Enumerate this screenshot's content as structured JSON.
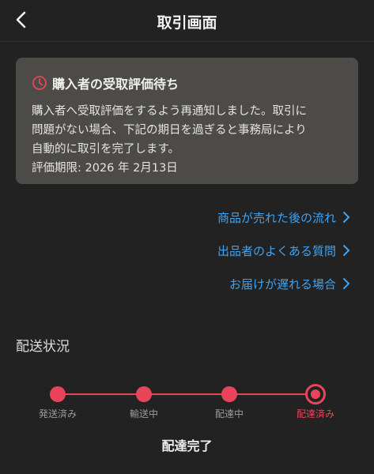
{
  "header": {
    "title": "取引画面",
    "back_icon": "chevron-left-icon"
  },
  "notice": {
    "icon": "clock-icon",
    "icon_color": "#e8455a",
    "title": "購入者の受取評価待ち",
    "lines": [
      "購入者へ受取評価をするよう再通知しました。取引に",
      "問題がない場合、下記の期日を過ぎると事務局により",
      "自動的に取引を完了します。",
      "評価期限: 2026 年 2月13日"
    ]
  },
  "links": [
    {
      "label": "商品が売れた後の流れ",
      "icon": "chevron-right-icon"
    },
    {
      "label": "出品者のよくある質問",
      "icon": "chevron-right-icon"
    },
    {
      "label": "お届けが遅れる場合",
      "icon": "chevron-right-icon"
    }
  ],
  "shipping": {
    "section_title": "配送状況",
    "steps": [
      {
        "label": "発送済み",
        "state": "done"
      },
      {
        "label": "輸送中",
        "state": "done"
      },
      {
        "label": "配達中",
        "state": "done"
      },
      {
        "label": "配達済み",
        "state": "current"
      }
    ],
    "status_text": "配達完了",
    "accent_color": "#e8455a"
  },
  "colors": {
    "background": "#222222",
    "notice_background": "#4c4b47",
    "link": "#3ea3f2"
  }
}
